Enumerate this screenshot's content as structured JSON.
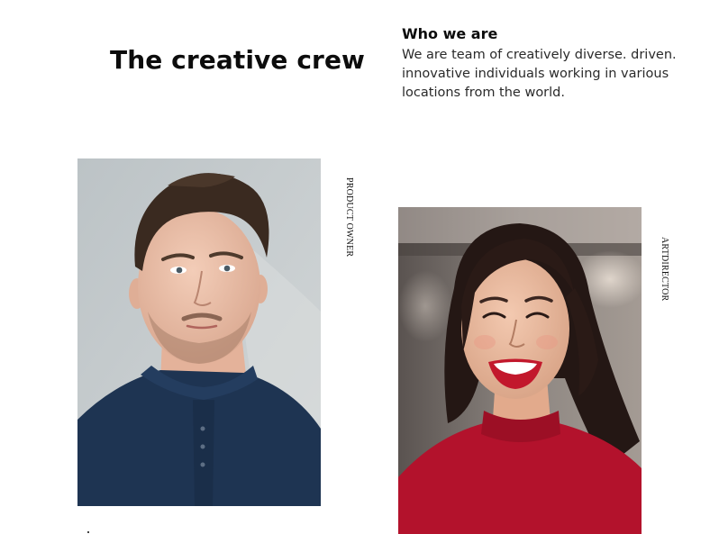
{
  "header": {
    "title": "The creative crew"
  },
  "about": {
    "heading": "Who we are",
    "text": "We are team of creatively diverse. driven. innovative individuals working in various locations from the world."
  },
  "team": [
    {
      "role": "PRODUCT OWNER",
      "photo": "portrait-photo-man",
      "shirt_color": "#1e3452",
      "background_color": "#c3c9cc"
    },
    {
      "role": "ARTDIRECTOR",
      "photo": "portrait-photo-woman",
      "top_color": "#b3122c",
      "background_color": "#7d7672"
    }
  ]
}
